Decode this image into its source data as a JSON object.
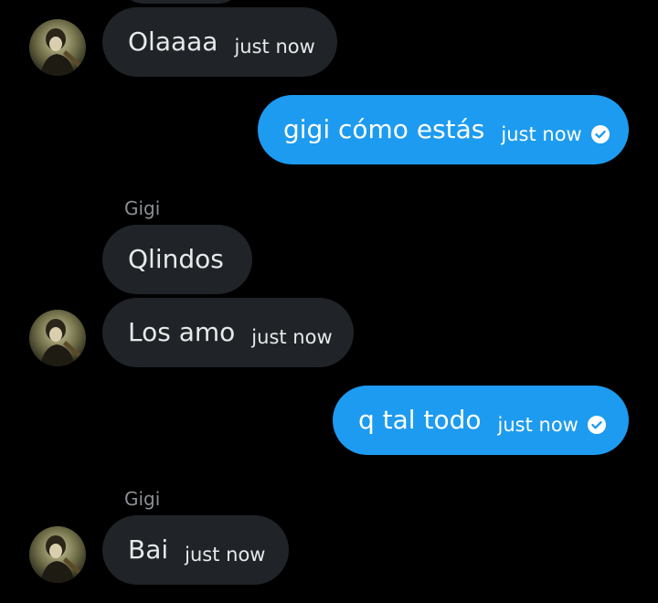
{
  "messages": [
    {
      "direction": "in",
      "text": "Olaaaa",
      "time": "just now"
    },
    {
      "direction": "out",
      "text": "gigi cómo estás",
      "time": "just now"
    },
    {
      "direction": "in",
      "sender": "Gigi",
      "text": "Qlindos",
      "time": ""
    },
    {
      "direction": "in",
      "text": "Los amo",
      "time": "just now"
    },
    {
      "direction": "out",
      "text": "q tal todo",
      "time": "just now"
    },
    {
      "direction": "in",
      "sender": "Gigi",
      "text": "Bai",
      "time": "just now"
    }
  ],
  "colors": {
    "background": "#000000",
    "incoming_bubble": "#202327",
    "outgoing_bubble": "#1d9bf0",
    "sender_name": "#8b8f94"
  },
  "icons": {
    "read_receipt": "check-circle-icon",
    "avatar": "user-avatar"
  }
}
